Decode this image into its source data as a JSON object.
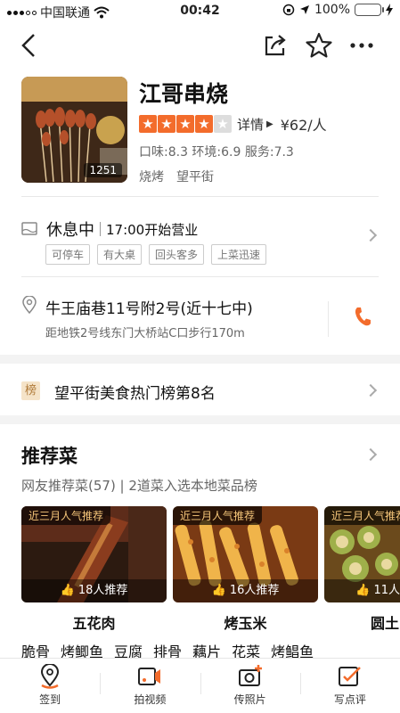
{
  "status_bar": {
    "carrier": "中国联通",
    "time": "00:42",
    "battery_percent": "100%"
  },
  "shop": {
    "name": "江哥串烧",
    "photo_count": "1251",
    "stars": 4,
    "details_label": "详情",
    "price": "¥62/人",
    "scores": "口味:8.3  环境:6.9  服务:7.3",
    "category": "烧烤",
    "area": "望平街"
  },
  "hours": {
    "status": "休息中",
    "open_time": "17:00开始营业",
    "features": [
      "可停车",
      "有大桌",
      "回头客多",
      "上菜迅速"
    ]
  },
  "address": {
    "line": "牛王庙巷11号附2号(近十七中)",
    "subway": "距地铁2号线东门大桥站C口步行170m"
  },
  "ranking": {
    "badge": "榜",
    "text": "望平街美食热门榜第8名"
  },
  "recommend": {
    "title": "推荐菜",
    "subtitle": "网友推荐菜(57) | 2道菜入选本地菜品榜",
    "dishes": [
      {
        "badge": "近三月人气推荐",
        "likes": "18人推荐",
        "name": "五花肉"
      },
      {
        "badge": "近三月人气推荐",
        "likes": "16人推荐",
        "name": "烤玉米"
      },
      {
        "badge": "近三月人气推荐",
        "likes": "11人",
        "name": "圆土"
      }
    ],
    "more_dishes": [
      "脆骨",
      "烤鲫鱼",
      "豆腐",
      "排骨",
      "藕片",
      "花菜",
      "烤鲳鱼"
    ]
  },
  "tabbar": {
    "items": [
      {
        "label": "签到"
      },
      {
        "label": "拍视频"
      },
      {
        "label": "传照片"
      },
      {
        "label": "写点评"
      }
    ]
  },
  "colors": {
    "accent": "#f36c2c",
    "star_off": "#dddddd",
    "gold_text": "#f7c77a"
  }
}
